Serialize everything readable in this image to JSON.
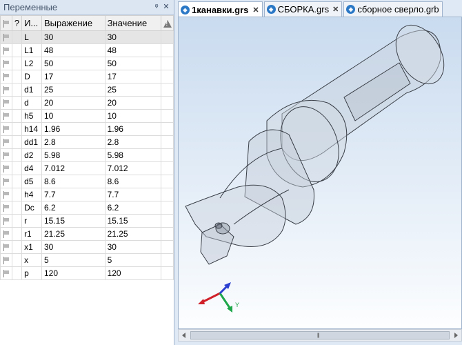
{
  "variables_panel": {
    "title": "Переменные",
    "pin_glyph": "ᵠ",
    "close_glyph": "✕",
    "columns": {
      "flag": "",
      "question": "?",
      "name": "И...",
      "expression": "Выражение",
      "value": "Значение",
      "warning": "!"
    },
    "rows": [
      {
        "name": "L",
        "expression": "30",
        "value": "30"
      },
      {
        "name": "L1",
        "expression": "48",
        "value": "48"
      },
      {
        "name": "L2",
        "expression": "50",
        "value": "50"
      },
      {
        "name": "D",
        "expression": "17",
        "value": "17"
      },
      {
        "name": "d1",
        "expression": "25",
        "value": "25"
      },
      {
        "name": "d",
        "expression": "20",
        "value": "20"
      },
      {
        "name": "h5",
        "expression": "10",
        "value": "10"
      },
      {
        "name": "h14",
        "expression": "1.96",
        "value": "1.96"
      },
      {
        "name": "dd1",
        "expression": "2.8",
        "value": "2.8"
      },
      {
        "name": "d2",
        "expression": "5.98",
        "value": "5.98"
      },
      {
        "name": "d4",
        "expression": "7.012",
        "value": "7.012"
      },
      {
        "name": "d5",
        "expression": "8.6",
        "value": "8.6"
      },
      {
        "name": "h4",
        "expression": "7.7",
        "value": "7.7"
      },
      {
        "name": "Dc",
        "expression": "6.2",
        "value": "6.2"
      },
      {
        "name": "r",
        "expression": "15.15",
        "value": "15.15"
      },
      {
        "name": "r1",
        "expression": "21.25",
        "value": "21.25"
      },
      {
        "name": "x1",
        "expression": "30",
        "value": "30"
      },
      {
        "name": "x",
        "expression": "5",
        "value": "5"
      },
      {
        "name": "p",
        "expression": "120",
        "value": "120"
      }
    ]
  },
  "tabs": [
    {
      "label": "1канавки.grs",
      "active": true,
      "close": "✕"
    },
    {
      "label": "СБОРКА.grs",
      "active": false,
      "close": "✕"
    },
    {
      "label": "сборное сверло.grb",
      "active": false,
      "close": "✕"
    }
  ],
  "viewport": {
    "axis_label_y": "Y",
    "axis_colors": {
      "x": "#d0202a",
      "y": "#1ea64a",
      "z": "#2a3fd0"
    },
    "background": "#d8e6f4"
  },
  "scrollbar": {
    "grip": "|||"
  }
}
